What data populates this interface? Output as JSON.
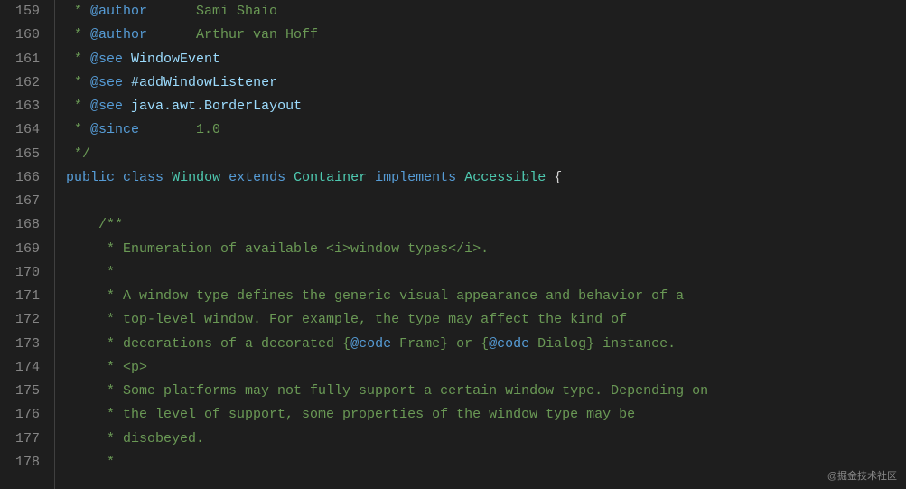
{
  "lines": [
    {
      "n": 159,
      "tokens": [
        {
          "cls": "asterisk",
          "t": " * "
        },
        {
          "cls": "tag",
          "t": "@author"
        },
        {
          "cls": "javadoc",
          "t": "      Sami Shaio"
        }
      ]
    },
    {
      "n": 160,
      "tokens": [
        {
          "cls": "asterisk",
          "t": " * "
        },
        {
          "cls": "tag",
          "t": "@author"
        },
        {
          "cls": "javadoc",
          "t": "      Arthur van Hoff"
        }
      ]
    },
    {
      "n": 161,
      "tokens": [
        {
          "cls": "asterisk",
          "t": " * "
        },
        {
          "cls": "tag",
          "t": "@see"
        },
        {
          "cls": "javadoc",
          "t": " "
        },
        {
          "cls": "tagval",
          "t": "WindowEvent"
        }
      ]
    },
    {
      "n": 162,
      "tokens": [
        {
          "cls": "asterisk",
          "t": " * "
        },
        {
          "cls": "tag",
          "t": "@see"
        },
        {
          "cls": "javadoc",
          "t": " "
        },
        {
          "cls": "tagval",
          "t": "#addWindowListener"
        }
      ]
    },
    {
      "n": 163,
      "tokens": [
        {
          "cls": "asterisk",
          "t": " * "
        },
        {
          "cls": "tag",
          "t": "@see"
        },
        {
          "cls": "javadoc",
          "t": " "
        },
        {
          "cls": "tagval",
          "t": "java.awt.BorderLayout"
        }
      ]
    },
    {
      "n": 164,
      "tokens": [
        {
          "cls": "asterisk",
          "t": " * "
        },
        {
          "cls": "tag",
          "t": "@since"
        },
        {
          "cls": "javadoc",
          "t": "       1.0"
        }
      ]
    },
    {
      "n": 165,
      "tokens": [
        {
          "cls": "asterisk",
          "t": " */"
        }
      ]
    },
    {
      "n": 166,
      "tokens": [
        {
          "cls": "kw",
          "t": "public"
        },
        {
          "cls": "punc",
          "t": " "
        },
        {
          "cls": "kw",
          "t": "class"
        },
        {
          "cls": "punc",
          "t": " "
        },
        {
          "cls": "type",
          "t": "Window"
        },
        {
          "cls": "punc",
          "t": " "
        },
        {
          "cls": "kw",
          "t": "extends"
        },
        {
          "cls": "punc",
          "t": " "
        },
        {
          "cls": "type",
          "t": "Container"
        },
        {
          "cls": "punc",
          "t": " "
        },
        {
          "cls": "kw",
          "t": "implements"
        },
        {
          "cls": "punc",
          "t": " "
        },
        {
          "cls": "type",
          "t": "Accessible"
        },
        {
          "cls": "punc",
          "t": " {"
        }
      ]
    },
    {
      "n": 167,
      "tokens": [
        {
          "cls": "punc",
          "t": " "
        }
      ]
    },
    {
      "n": 168,
      "tokens": [
        {
          "cls": "asterisk",
          "t": "    /**"
        }
      ]
    },
    {
      "n": 169,
      "tokens": [
        {
          "cls": "asterisk",
          "t": "     * "
        },
        {
          "cls": "javadoc",
          "t": "Enumeration of available <i>window types</i>."
        }
      ]
    },
    {
      "n": 170,
      "tokens": [
        {
          "cls": "asterisk",
          "t": "     *"
        }
      ]
    },
    {
      "n": 171,
      "tokens": [
        {
          "cls": "asterisk",
          "t": "     * "
        },
        {
          "cls": "javadoc",
          "t": "A window type defines the generic visual appearance and behavior of a"
        }
      ]
    },
    {
      "n": 172,
      "tokens": [
        {
          "cls": "asterisk",
          "t": "     * "
        },
        {
          "cls": "javadoc",
          "t": "top-level window. For example, the type may affect the kind of"
        }
      ]
    },
    {
      "n": 173,
      "tokens": [
        {
          "cls": "asterisk",
          "t": "     * "
        },
        {
          "cls": "javadoc",
          "t": "decorations of a decorated {"
        },
        {
          "cls": "atcode",
          "t": "@code"
        },
        {
          "cls": "javadoc",
          "t": " Frame} or {"
        },
        {
          "cls": "atcode",
          "t": "@code"
        },
        {
          "cls": "javadoc",
          "t": " Dialog} instance."
        }
      ]
    },
    {
      "n": 174,
      "tokens": [
        {
          "cls": "asterisk",
          "t": "     * "
        },
        {
          "cls": "javadoc",
          "t": "<p>"
        }
      ]
    },
    {
      "n": 175,
      "tokens": [
        {
          "cls": "asterisk",
          "t": "     * "
        },
        {
          "cls": "javadoc",
          "t": "Some platforms may not fully support a certain window type. Depending on"
        }
      ]
    },
    {
      "n": 176,
      "tokens": [
        {
          "cls": "asterisk",
          "t": "     * "
        },
        {
          "cls": "javadoc",
          "t": "the level of support, some properties of the window type may be"
        }
      ]
    },
    {
      "n": 177,
      "tokens": [
        {
          "cls": "asterisk",
          "t": "     * "
        },
        {
          "cls": "javadoc",
          "t": "disobeyed."
        }
      ]
    },
    {
      "n": 178,
      "tokens": [
        {
          "cls": "asterisk",
          "t": "     *"
        }
      ]
    }
  ],
  "watermark": "@掘金技术社区"
}
